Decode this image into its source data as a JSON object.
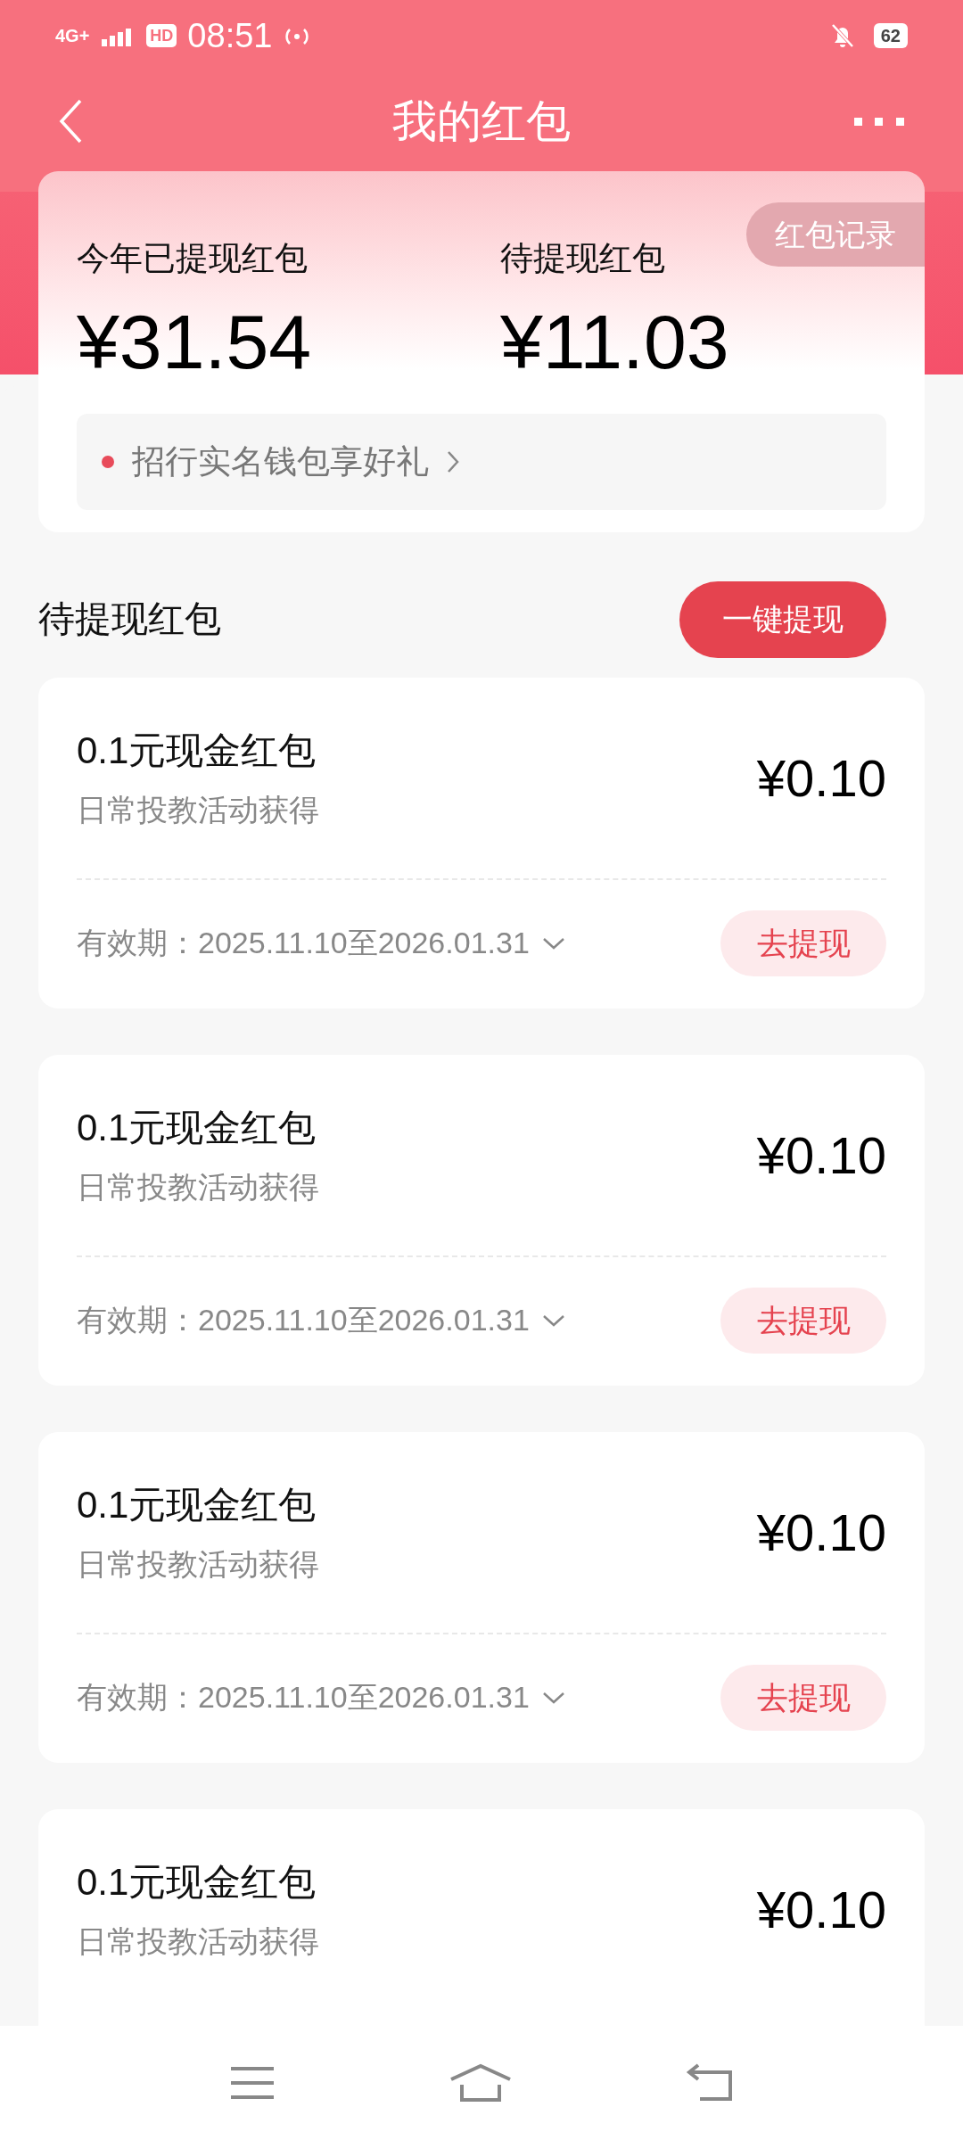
{
  "status_bar": {
    "network": "4G+",
    "hd": "HD",
    "time": "08:51",
    "battery": "62"
  },
  "nav": {
    "title": "我的红包"
  },
  "summary": {
    "record_button": "红包记录",
    "withdrawn_label": "今年已提现红包",
    "withdrawn_amount": "¥31.54",
    "pending_label": "待提现红包",
    "pending_amount": "¥11.03",
    "promo": "招行实名钱包享好礼"
  },
  "section": {
    "title": "待提现红包",
    "action": "一键提现"
  },
  "packets": [
    {
      "title": "0.1元现金红包",
      "source": "日常投教活动获得",
      "amount": "¥0.10",
      "validity": "有效期：2025.11.10至2026.01.31",
      "button": "去提现"
    },
    {
      "title": "0.1元现金红包",
      "source": "日常投教活动获得",
      "amount": "¥0.10",
      "validity": "有效期：2025.11.10至2026.01.31",
      "button": "去提现"
    },
    {
      "title": "0.1元现金红包",
      "source": "日常投教活动获得",
      "amount": "¥0.10",
      "validity": "有效期：2025.11.10至2026.01.31",
      "button": "去提现"
    },
    {
      "title": "0.1元现金红包",
      "source": "日常投教活动获得",
      "amount": "¥0.10"
    }
  ]
}
